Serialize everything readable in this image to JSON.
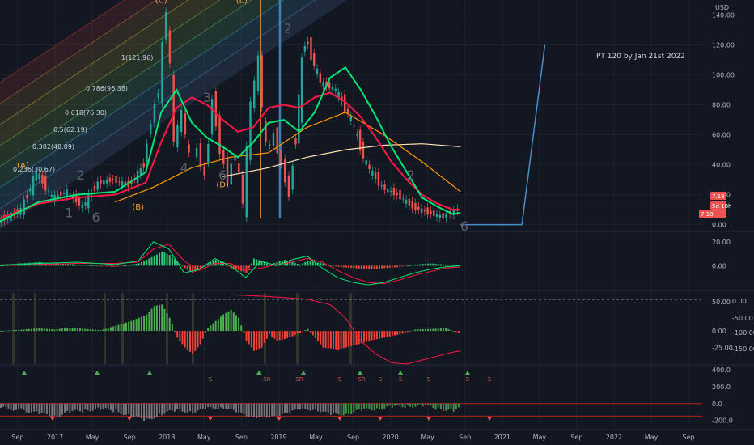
{
  "colors": {
    "bg": "#131722",
    "grid": "#1e222d",
    "text": "#b2b5be",
    "up": "#26a69a",
    "down": "#ef5350",
    "green": "#00e676",
    "red": "#ff1744",
    "orange": "#ff9800",
    "cream": "#ffe0b2",
    "blue": "#2962ff",
    "steel": "#4a90c8",
    "wave_orange": "#f7a440",
    "wave_gray": "#5d606b"
  },
  "chart_data": [
    {
      "type": "line",
      "panel": "price",
      "y_ticks": [
        140,
        120,
        100,
        80,
        60,
        40,
        20,
        0
      ],
      "y_tick_labels": [
        "140.00",
        "120.00",
        "100.00",
        "80.00",
        "60.00",
        "40.00",
        "20.00",
        "0.00"
      ],
      "ylim": [
        -4,
        150
      ],
      "currency_label": "USD",
      "x_tick_labels": [
        "Sep",
        "2017",
        "May",
        "Sep",
        "2018",
        "May",
        "Sep",
        "2019",
        "May",
        "Sep",
        "2020",
        "May",
        "Sep",
        "2021",
        "May",
        "Sep",
        "2022",
        "May",
        "Sep"
      ],
      "price_series": {
        "name": "",
        "x": [
          0,
          6,
          10,
          14,
          18,
          22,
          26,
          30,
          34,
          38,
          40,
          42,
          44,
          46,
          48,
          50,
          52,
          54,
          56,
          58,
          60,
          62,
          64,
          66,
          68,
          70,
          72,
          74,
          76,
          80,
          84,
          88,
          92,
          96,
          100,
          104,
          108,
          112,
          116,
          118,
          120
        ],
        "values": [
          2,
          10,
          35,
          18,
          22,
          12,
          28,
          30,
          26,
          40,
          70,
          90,
          145,
          55,
          75,
          45,
          50,
          32,
          85,
          50,
          30,
          48,
          15,
          80,
          110,
          50,
          60,
          40,
          20,
          125,
          95,
          90,
          70,
          40,
          25,
          20,
          12,
          8,
          5,
          8,
          10
        ]
      },
      "ma_fast": {
        "x": [
          0,
          10,
          20,
          30,
          38,
          42,
          46,
          50,
          54,
          58,
          62,
          66,
          70,
          74,
          78,
          82,
          86,
          90,
          94,
          98,
          102,
          106,
          110,
          114,
          118,
          120
        ],
        "values": [
          2,
          15,
          20,
          22,
          35,
          75,
          90,
          68,
          58,
          52,
          45,
          55,
          68,
          70,
          62,
          75,
          98,
          105,
          90,
          72,
          52,
          35,
          18,
          12,
          7,
          8
        ]
      },
      "ma_slow": {
        "x": [
          0,
          10,
          20,
          30,
          38,
          42,
          46,
          50,
          54,
          58,
          62,
          66,
          70,
          74,
          78,
          82,
          86,
          90,
          94,
          98,
          102,
          106,
          110,
          114,
          118,
          120
        ],
        "values": [
          4,
          14,
          18,
          20,
          28,
          55,
          78,
          85,
          80,
          70,
          62,
          65,
          78,
          80,
          78,
          85,
          88,
          82,
          72,
          58,
          42,
          30,
          20,
          14,
          10,
          10
        ]
      },
      "ma_long": {
        "x": [
          30,
          40,
          50,
          60,
          70,
          80,
          90,
          100,
          110,
          120
        ],
        "values": [
          15,
          25,
          38,
          45,
          48,
          65,
          75,
          60,
          42,
          22
        ]
      },
      "ma_200": {
        "x": [
          58,
          70,
          80,
          90,
          100,
          110,
          120
        ],
        "values": [
          32,
          38,
          45,
          50,
          53,
          54,
          52
        ]
      },
      "projection": {
        "x": [
          120,
          136,
          142
        ],
        "values": [
          0,
          0,
          120
        ],
        "label": "PT 120 by Jan 21st 2022"
      },
      "fib_levels": [
        {
          "label": "1(121.96)",
          "value": 121.96
        },
        {
          "label": "0.786(96.38)",
          "value": 96.38
        },
        {
          "label": "0.618(76.30)",
          "value": 76.3
        },
        {
          "label": "0.5(62.19)",
          "value": 62.19
        },
        {
          "label": "0.382(48.09)",
          "value": 48.09
        },
        {
          "label": "0.236(30.67)",
          "value": 30.67
        }
      ],
      "wave_labels": [
        {
          "text": "(A)",
          "x": 6,
          "y": 38
        },
        {
          "text": "(B)",
          "x": 36,
          "y": 10
        },
        {
          "text": "(C)",
          "x": 42,
          "y": 148
        },
        {
          "text": "(D)",
          "x": 58,
          "y": 25
        },
        {
          "text": "(E)",
          "x": 63,
          "y": 148
        },
        {
          "text": "1",
          "x": 18,
          "y": 5
        },
        {
          "text": "2",
          "x": 21,
          "y": 30
        },
        {
          "text": "3",
          "x": 54,
          "y": 82
        },
        {
          "text": "4",
          "x": 48,
          "y": 35
        },
        {
          "text": "6",
          "x": 25,
          "y": 2
        },
        {
          "text": "6",
          "x": 58,
          "y": 30
        },
        {
          "text": "2",
          "x": 75,
          "y": 128
        },
        {
          "text": "2",
          "x": 107,
          "y": 30
        },
        {
          "text": "6",
          "x": 121,
          "y": -4
        }
      ],
      "price_badges": [
        {
          "label": "7.18",
          "value": 7.18
        },
        {
          "label": "5d 18h",
          "value": 1.5
        },
        {
          "label": "7.18",
          "value": -3.5
        }
      ]
    },
    {
      "type": "bar",
      "panel": "macd",
      "y_ticks": [
        20,
        0
      ],
      "y_tick_labels": [
        "20.00",
        "0.00"
      ],
      "ylim": [
        -20,
        28
      ],
      "histogram": {
        "x": [
          0,
          10,
          20,
          30,
          36,
          40,
          42,
          44,
          46,
          48,
          50,
          52,
          54,
          56,
          58,
          60,
          62,
          64,
          66,
          68,
          70,
          72,
          74,
          76,
          78,
          80,
          84,
          88,
          92,
          96,
          100,
          104,
          108,
          112,
          116,
          120
        ],
        "values": [
          1,
          3,
          1,
          -1,
          2,
          8,
          12,
          9,
          4,
          -2,
          -6,
          -3,
          2,
          5,
          3,
          -2,
          -4,
          -6,
          6,
          4,
          1,
          3,
          5,
          3,
          1,
          4,
          2,
          -1,
          -2,
          -3,
          -2,
          -1,
          1,
          2,
          1,
          0
        ]
      },
      "macd_line": {
        "x": [
          0,
          10,
          20,
          30,
          36,
          40,
          44,
          48,
          52,
          56,
          60,
          64,
          68,
          72,
          76,
          80,
          84,
          88,
          92,
          96,
          100,
          104,
          108,
          112,
          116,
          120
        ],
        "values": [
          0,
          2,
          3,
          1,
          4,
          20,
          14,
          -6,
          -3,
          6,
          0,
          -10,
          4,
          0,
          5,
          8,
          -2,
          -10,
          -14,
          -16,
          -14,
          -10,
          -6,
          -3,
          -1,
          0
        ]
      },
      "signal_line": {
        "x": [
          0,
          10,
          20,
          30,
          36,
          40,
          44,
          48,
          52,
          56,
          60,
          64,
          68,
          72,
          76,
          80,
          84,
          88,
          92,
          96,
          100,
          104,
          108,
          112,
          116,
          120
        ],
        "values": [
          0,
          1,
          2,
          2,
          3,
          14,
          18,
          4,
          -4,
          2,
          2,
          -4,
          -2,
          1,
          3,
          6,
          3,
          -4,
          -10,
          -14,
          -15,
          -12,
          -8,
          -5,
          -2,
          -1
        ]
      }
    },
    {
      "type": "bar",
      "panel": "oscillator",
      "y_ticks_left": [
        50,
        0,
        -25
      ],
      "y_tick_labels_left": [
        "50.00",
        "0.00",
        "-25.00"
      ],
      "y_tick_labels_right": [
        "0.00",
        "-50.00",
        "-100.00",
        "-150.00"
      ],
      "ylim": [
        -50,
        60
      ],
      "histogram": {
        "x": [
          0,
          6,
          10,
          14,
          18,
          22,
          26,
          30,
          34,
          38,
          40,
          42,
          44,
          46,
          48,
          50,
          52,
          54,
          56,
          58,
          60,
          62,
          64,
          66,
          68,
          70,
          72,
          74,
          76,
          80,
          84,
          88,
          92,
          96,
          100,
          104,
          108,
          112,
          116,
          120
        ],
        "values": [
          0,
          2,
          4,
          2,
          5,
          3,
          1,
          8,
          15,
          25,
          38,
          40,
          20,
          -10,
          -25,
          -35,
          -20,
          5,
          15,
          25,
          32,
          20,
          -15,
          -30,
          -25,
          -5,
          -15,
          -12,
          -8,
          3,
          -25,
          -28,
          -22,
          -15,
          -10,
          -5,
          2,
          3,
          4,
          -4
        ]
      },
      "line": {
        "x": [
          60,
          70,
          80,
          86,
          90,
          94,
          98,
          102,
          106,
          110,
          114,
          118,
          120
        ],
        "values": [
          55,
          52,
          48,
          40,
          20,
          -15,
          -35,
          -48,
          -50,
          -44,
          -38,
          -32,
          -30
        ]
      }
    },
    {
      "type": "bar",
      "panel": "signals",
      "y_ticks": [
        400,
        200,
        0,
        -200
      ],
      "y_tick_labels": [
        "400.0",
        "200.0",
        "0.0",
        "-200.0"
      ],
      "ylim": [
        -300,
        450
      ],
      "histogram": {
        "x": [
          0,
          6,
          10,
          14,
          18,
          22,
          26,
          30,
          34,
          38,
          42,
          46,
          50,
          54,
          58,
          62,
          66,
          70,
          74,
          78,
          82,
          86,
          90,
          94,
          98,
          102,
          106,
          110,
          114,
          118,
          120
        ],
        "values": [
          -50,
          -80,
          -120,
          -150,
          -100,
          -80,
          -60,
          -90,
          -150,
          -200,
          -120,
          -80,
          -100,
          -60,
          -40,
          -120,
          -150,
          -180,
          -100,
          -80,
          -60,
          -140,
          -120,
          -80,
          -60,
          -40,
          -30,
          -20,
          -60,
          -80,
          -50
        ]
      },
      "signal_marks": [
        "S",
        "S",
        "SR",
        "S",
        "S",
        "S",
        "S",
        "S",
        "SR",
        "SR"
      ]
    }
  ]
}
